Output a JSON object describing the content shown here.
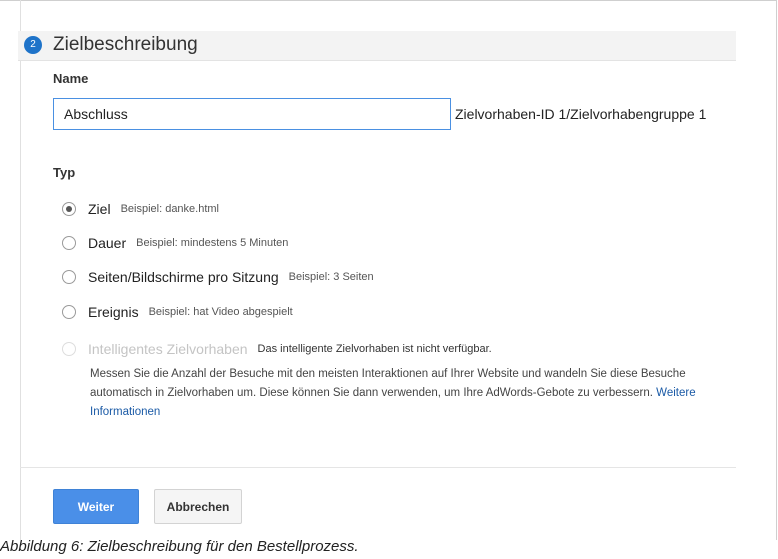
{
  "step": {
    "number": "2",
    "title": "Zielbeschreibung"
  },
  "name_section": {
    "label": "Name",
    "input_value": "Abschluss",
    "goal_id_text": "Zielvorhaben-ID 1/Zielvorhabengruppe 1"
  },
  "type_section": {
    "label": "Typ",
    "options": [
      {
        "label": "Ziel",
        "example": "Beispiel: danke.html",
        "selected": true
      },
      {
        "label": "Dauer",
        "example": "Beispiel: mindestens 5 Minuten",
        "selected": false
      },
      {
        "label": "Seiten/Bildschirme pro Sitzung",
        "example": "Beispiel: 3 Seiten",
        "selected": false
      },
      {
        "label": "Ereignis",
        "example": "Beispiel: hat Video abgespielt",
        "selected": false
      },
      {
        "label": "Intelligentes Zielvorhaben",
        "example": "Das intelligente Zielvorhaben ist nicht verfügbar.",
        "selected": false,
        "disabled": true
      }
    ],
    "smart_goal_description": "Messen Sie die Anzahl der Besuche mit den meisten Interaktionen auf Ihrer Website und wandeln Sie diese Besuche automatisch in Zielvorhaben um. Diese können Sie dann verwenden, um Ihre AdWords-Gebote zu verbessern.",
    "more_info_link": "Weitere Informationen"
  },
  "buttons": {
    "continue": "Weiter",
    "cancel": "Abbrechen"
  },
  "caption": "Abbildung 6: Zielbeschreibung für den Bestellprozess."
}
